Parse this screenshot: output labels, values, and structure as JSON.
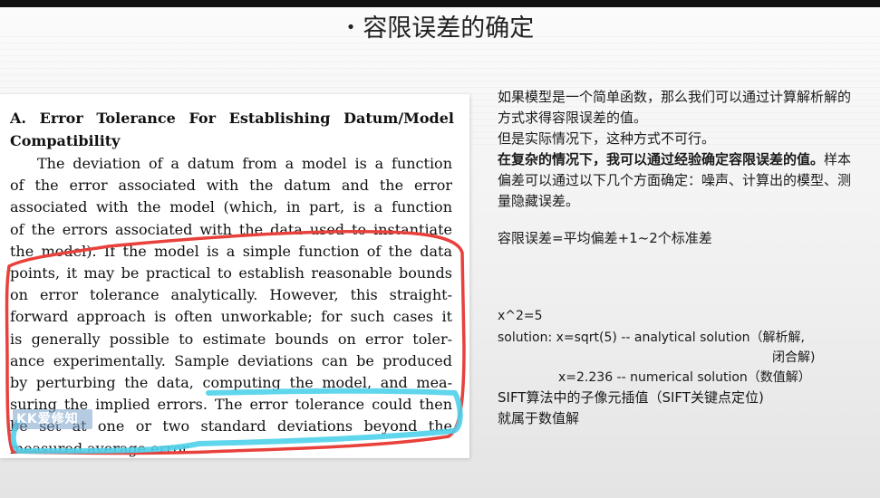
{
  "slide": {
    "title": "容限误差的确定",
    "bullet": "•"
  },
  "excerpt": {
    "heading_line1": "A. Error Tolerance For Establishing Datum/Model",
    "heading_line2": "Compatibility",
    "lines": [
      "The deviation of a datum from a model is a function",
      "of the error associated with the datum and the error",
      "associated with the model (which, in part, is a function",
      "of the errors associated with the data used to instantiate",
      "the model). If the model is a simple function of the data",
      "points, it may be practical to establish reasonable bounds",
      "on error tolerance analytically. However, this straight-",
      "forward approach is often unworkable; for such cases it",
      "is generally possible to estimate bounds on error toler-",
      "ance experimentally. Sample deviations can be produced",
      "by perturbing the data, computing the model, and mea-",
      "suring the implied errors. The error tolerance could then",
      "be set at one or two standard deviations beyond the",
      "measured average error."
    ],
    "watermark": "KK爱修知",
    "annotation_colors": {
      "red": "#e8413c",
      "cyan": "#4fd2ea"
    }
  },
  "notes": {
    "para1": "如果模型是一个简单函数，那么我们可以通过计算解析解的方式求得容限误差的值。",
    "para2": "但是实际情况下，这种方式不可行。",
    "para3_bold": "在复杂的情况下，我可以通过经验确定容限误差的值。",
    "para3_rest": "样本偏差可以通过以下几个方面确定：噪声、计算出的模型、测量隐藏误差。",
    "formula": "容限误差=平均偏差+1~2个标准差",
    "x2": "x^2=5",
    "solution": "solution: x=sqrt(5) -- analytical solution（解析解,",
    "closed": "闭合解)",
    "numerical": "x=2.236 --   numerical solution（数值解）",
    "sift": "SIFT算法中的子像元插值（SIFT关键点定位)",
    "sift2": "就属于数值解"
  }
}
